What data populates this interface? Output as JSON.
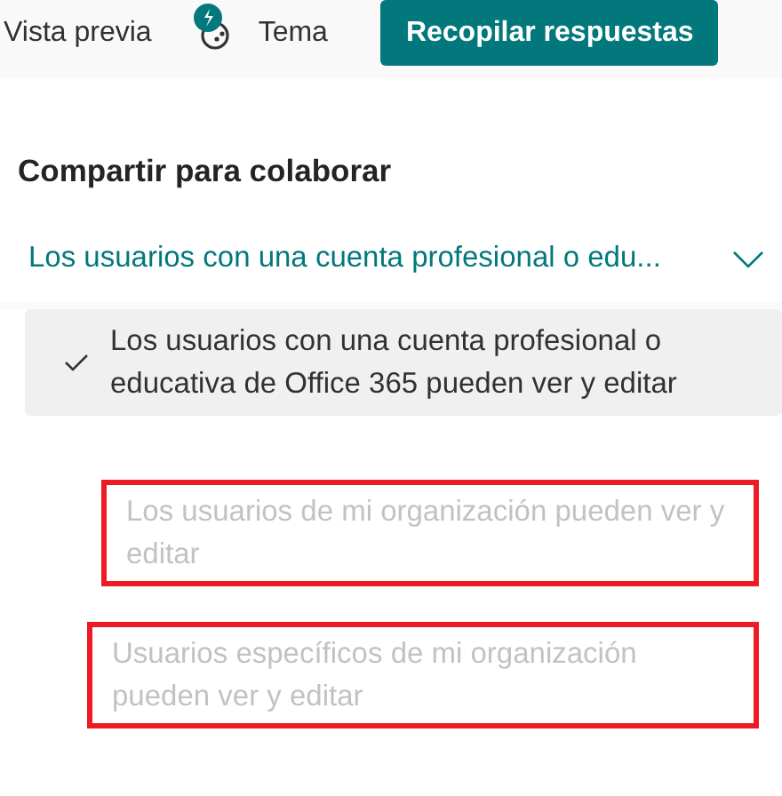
{
  "toolbar": {
    "preview": "Vista previa",
    "theme": "Tema",
    "collect_button": "Recopilar respuestas"
  },
  "section_title": "Compartir para colaborar",
  "dropdown": {
    "value": "Los usuarios con una cuenta profesional o edu...",
    "expanded": true
  },
  "options": [
    {
      "label": "Los usuarios con una cuenta profesional o educativa de Office 365 pueden ver y editar",
      "selected": true,
      "disabled": false,
      "highlighted": false
    },
    {
      "label": "Los usuarios de mi organización pueden ver y editar",
      "selected": false,
      "disabled": true,
      "highlighted": true
    },
    {
      "label": "Usuarios específicos de mi organización pueden ver y editar",
      "selected": false,
      "disabled": true,
      "highlighted": true
    }
  ]
}
